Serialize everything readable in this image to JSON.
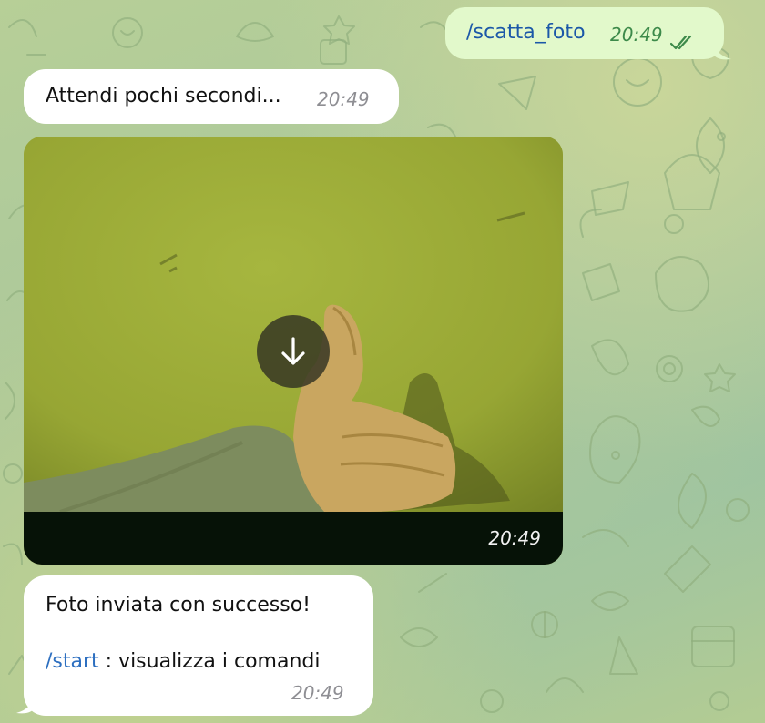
{
  "chat": {
    "messages": [
      {
        "direction": "outgoing",
        "text": "/scatta_foto",
        "time": "20:49",
        "status_icon": "double-check-icon"
      },
      {
        "direction": "incoming",
        "text": "Attendi pochi secondi...",
        "time": "20:49"
      },
      {
        "direction": "incoming",
        "type": "photo",
        "time": "20:49",
        "action_icon": "download-arrow-icon"
      },
      {
        "direction": "incoming",
        "line1": "Foto inviata con successo!",
        "command": "/start",
        "command_suffix": " : visualizza i comandi",
        "time": "20:49"
      }
    ]
  },
  "colors": {
    "outgoing_bubble": "#e2f9cb",
    "incoming_bubble": "#ffffff",
    "link": "#2d6fc0",
    "outgoing_time": "#3d8a4a",
    "incoming_time": "#8e8e93"
  }
}
